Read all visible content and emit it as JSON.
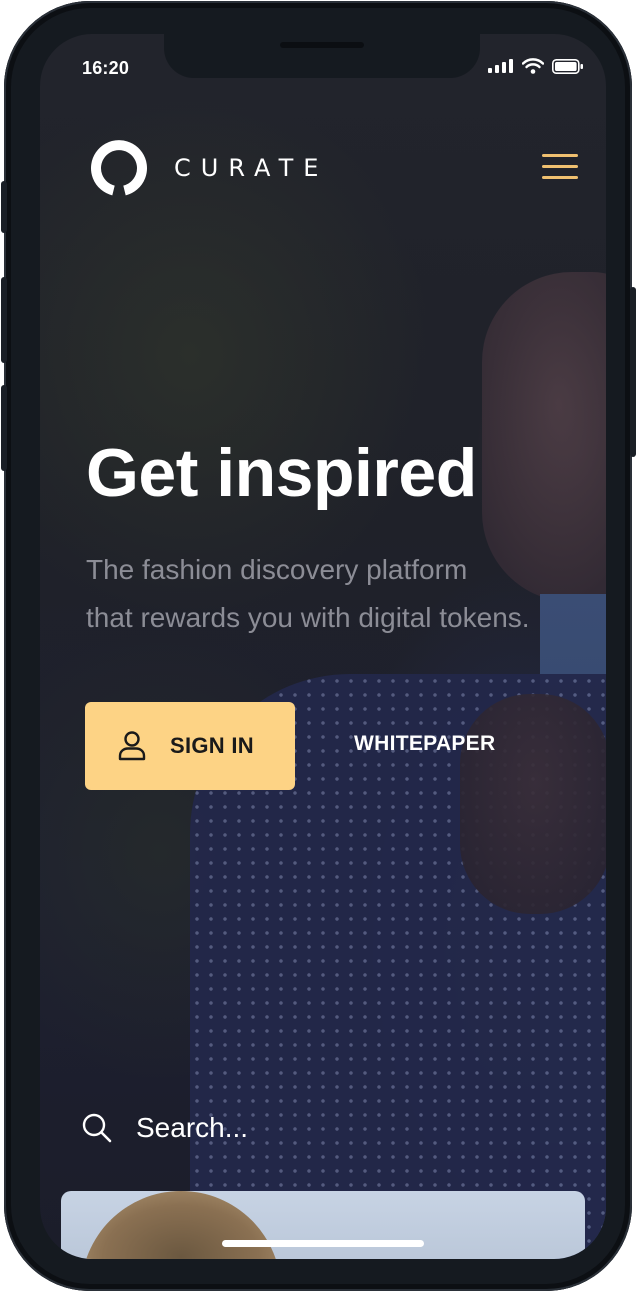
{
  "status_bar": {
    "time": "16:20"
  },
  "header": {
    "brand": "CURATE"
  },
  "hero": {
    "title": "Get inspired",
    "subtitle_line1": "The fashion discovery platform",
    "subtitle_line2": "that rewards you with digital tokens."
  },
  "actions": {
    "signin_label": "SIGN IN",
    "whitepaper_label": "WHITEPAPER"
  },
  "search": {
    "placeholder": "Search..."
  },
  "colors": {
    "accent": "#fdd385",
    "menu": "#f0c070",
    "subtitle": "#8c8d96"
  },
  "icons": [
    "signal-icon",
    "wifi-icon",
    "battery-icon",
    "curate-logo-icon",
    "hamburger-menu-icon",
    "user-icon",
    "search-icon"
  ]
}
